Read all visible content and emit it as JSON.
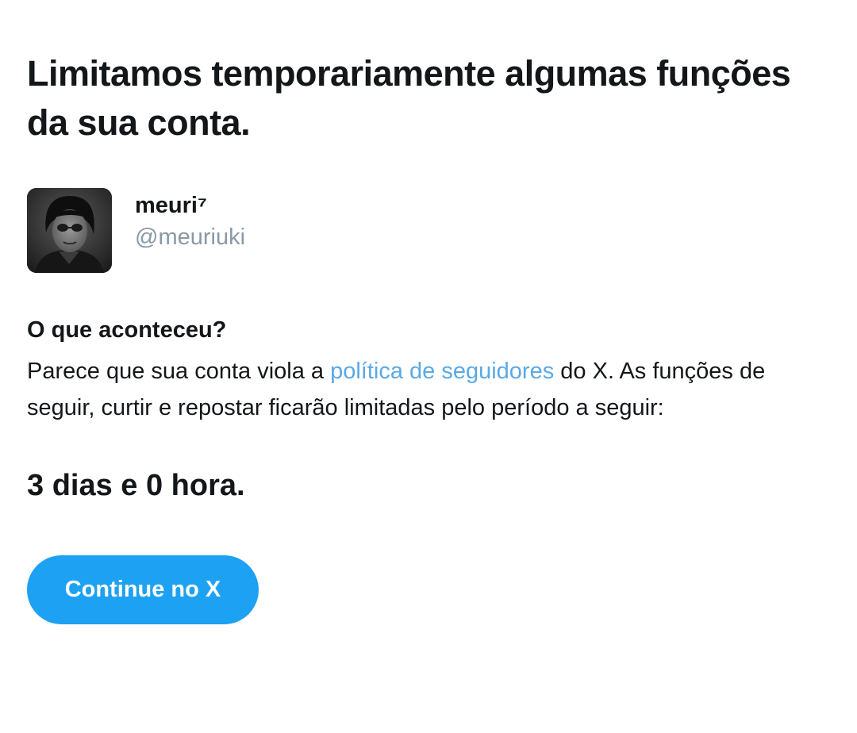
{
  "header": {
    "title": "Limitamos temporariamente algumas funções da sua conta."
  },
  "profile": {
    "display_name": "meuri⁷",
    "username": "@meuriuki"
  },
  "notice": {
    "heading": "O que aconteceu?",
    "body_before_link": "Parece que sua conta viola a ",
    "link_text": "política de seguidores",
    "body_after_link": " do X. As funções de seguir, curtir e repostar ficarão limitadas pelo período a seguir:",
    "duration": "3 dias e 0 hora."
  },
  "actions": {
    "continue_label": "Continue no X"
  },
  "colors": {
    "text": "#14171a",
    "muted": "#8899a6",
    "link": "#5aa9e6",
    "button": "#1da1f2"
  }
}
